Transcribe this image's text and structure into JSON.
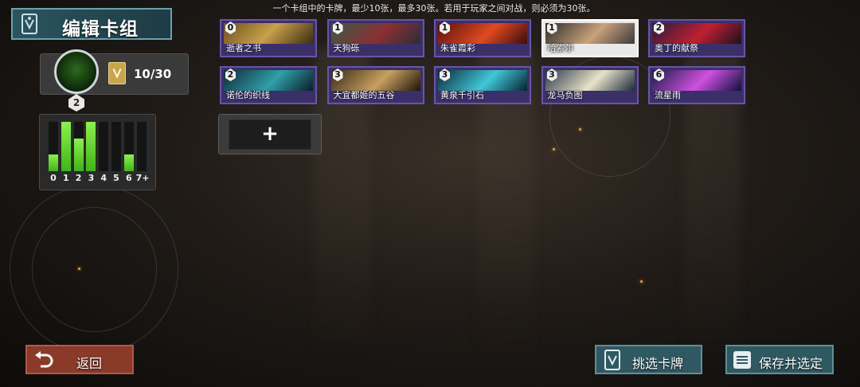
{
  "top_note": "一个卡组中的卡牌，最少10张，最多30张。若用于玩家之间对战，则必须为30张。",
  "header": {
    "title": "编辑卡组"
  },
  "deck_count": {
    "text": "10/30",
    "portrait_badge": "2"
  },
  "mana_curve": {
    "labels": [
      "0",
      "1",
      "2",
      "3",
      "4",
      "5",
      "6",
      "7+"
    ],
    "counts": [
      1,
      3,
      2,
      3,
      0,
      0,
      1,
      0
    ],
    "bar_color": "#5fdc2a"
  },
  "deck": [
    {
      "name": "逝者之书",
      "cost": "0"
    },
    {
      "name": "天狗砾",
      "cost": "1"
    },
    {
      "name": "朱雀霞彩",
      "cost": "1"
    },
    {
      "name": "哈索尔",
      "cost": "1",
      "selected": true
    },
    {
      "name": "奥丁的献祭",
      "cost": "2"
    },
    {
      "name": "诺伦的织线",
      "cost": "2"
    },
    {
      "name": "大宜都姬的五谷",
      "cost": "3"
    },
    {
      "name": "黄泉千引石",
      "cost": "3"
    },
    {
      "name": "龙马负图",
      "cost": "3"
    },
    {
      "name": "流星雨",
      "cost": "6"
    }
  ],
  "add_slot": {
    "symbol": "+"
  },
  "buttons": {
    "back": "返回",
    "pick_cards": "挑选卡牌",
    "save_and_select": "保存并选定"
  }
}
